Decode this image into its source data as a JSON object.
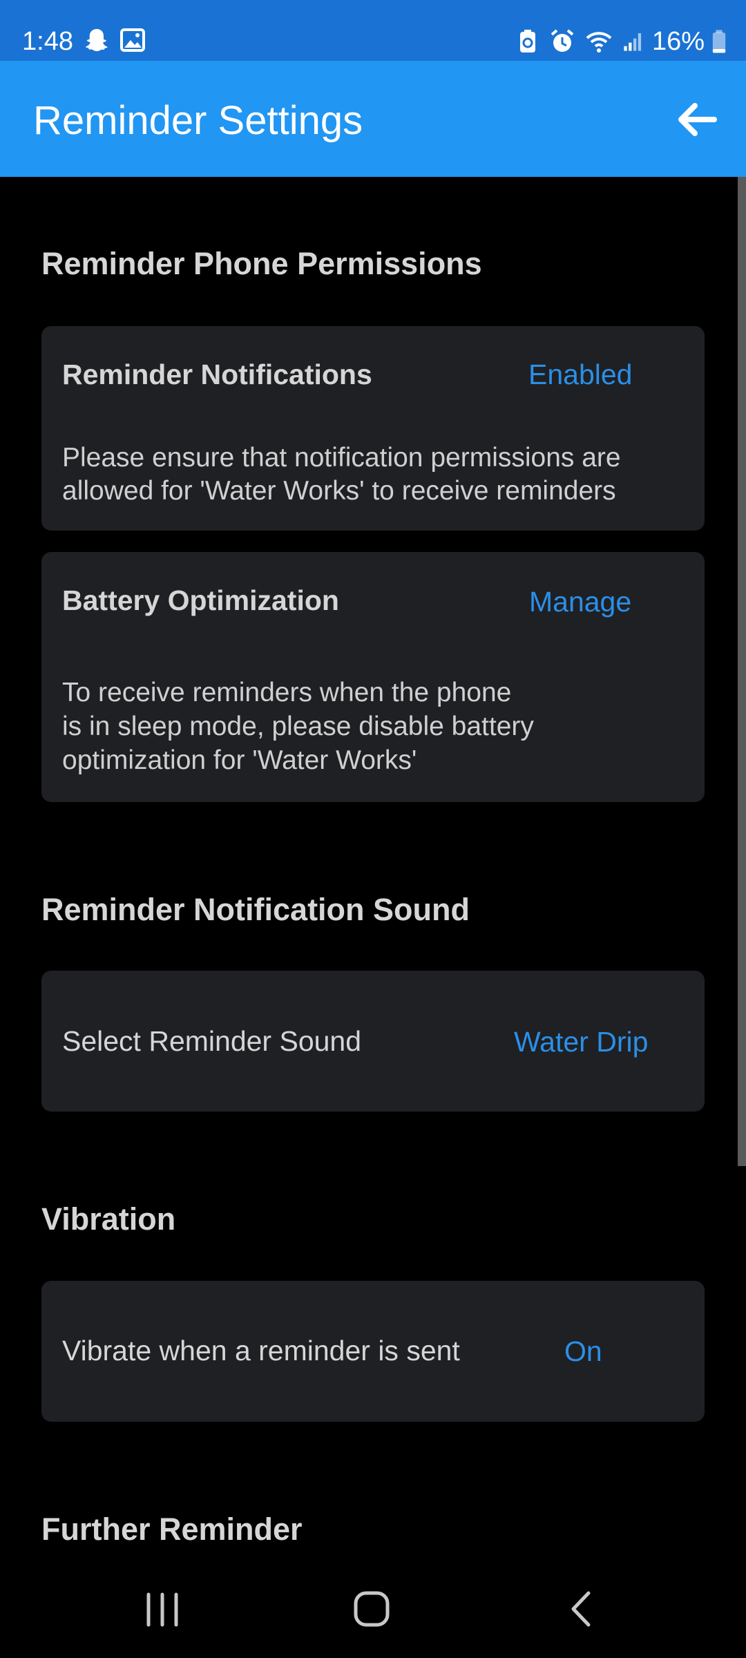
{
  "status_bar": {
    "time": "1:48",
    "battery": "16%",
    "left_icons": [
      "snapchat-icon",
      "image-icon"
    ],
    "right_icons": [
      "battery-saver-icon",
      "alarm-icon",
      "wifi-icon",
      "signal-icon",
      "battery-icon"
    ]
  },
  "app_bar": {
    "title": "Reminder Settings",
    "back_icon": "arrow-back-icon"
  },
  "sections": {
    "permissions": {
      "title": "Reminder Phone Permissions",
      "notifications": {
        "title": "Reminder Notifications",
        "action": "Enabled",
        "desc_line1": "Please ensure that notification permissions are",
        "desc_line2": "allowed for 'Water Works' to receive reminders"
      },
      "battery": {
        "title": "Battery Optimization",
        "action": "Manage",
        "desc_line1": "To receive reminders when the phone",
        "desc_line2": "is in sleep mode, please disable battery",
        "desc_line3": "optimization for 'Water Works'"
      }
    },
    "sound": {
      "title": "Reminder Notification Sound",
      "label": "Select Reminder Sound",
      "value": "Water Drip"
    },
    "vibration": {
      "title": "Vibration",
      "label": "Vibrate when a reminder is sent",
      "value": "On"
    },
    "further": {
      "title": "Further Reminder"
    }
  },
  "nav_bar": {
    "icons": [
      "recent-apps-icon",
      "home-icon",
      "back-icon"
    ]
  },
  "colors": {
    "status_bar": "#1a73d4",
    "app_bar": "#2196f3",
    "accent": "#2b8fe8",
    "card": "#1f2023",
    "background": "#000000"
  }
}
